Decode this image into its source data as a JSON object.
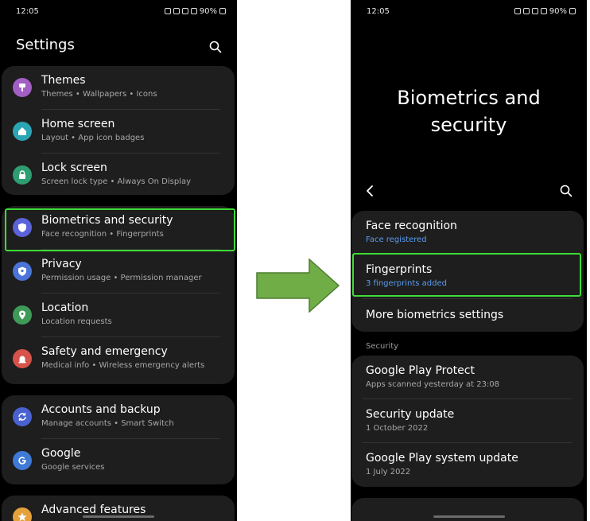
{
  "colors": {
    "highlight": "#3ddc36",
    "arrow_fill": "#70ad47",
    "arrow_stroke": "#4e7d30",
    "link_blue": "#5a9cf0",
    "themes_icon": "#a25fc4",
    "home_icon": "#2aa5b4",
    "lock_icon": "#2f9d72",
    "biometrics_icon": "#5a63d8",
    "privacy_icon": "#4a74d8",
    "location_icon": "#3e9a57",
    "safety_icon": "#d6524a",
    "accounts_icon": "#4a62d0",
    "google_icon": "#3e7ad6",
    "advanced_icon": "#e5a13a"
  },
  "left": {
    "status": {
      "time": "12:05",
      "battery": "90%"
    },
    "header": {
      "title": "Settings",
      "search_icon": "search-icon"
    },
    "group1": [
      {
        "title": "Themes",
        "subtitle": "Themes • Wallpapers • Icons",
        "icon": "themes-icon"
      },
      {
        "title": "Home screen",
        "subtitle": "Layout • App icon badges",
        "icon": "home-icon"
      },
      {
        "title": "Lock screen",
        "subtitle": "Screen lock type • Always On Display",
        "icon": "lock-icon"
      }
    ],
    "group2": [
      {
        "title": "Biometrics and security",
        "subtitle": "Face recognition • Fingerprints",
        "icon": "shield-icon"
      },
      {
        "title": "Privacy",
        "subtitle": "Permission usage • Permission manager",
        "icon": "privacy-shield-icon"
      },
      {
        "title": "Location",
        "subtitle": "Location requests",
        "icon": "location-pin-icon"
      },
      {
        "title": "Safety and emergency",
        "subtitle": "Medical info • Wireless emergency alerts",
        "icon": "siren-icon"
      }
    ],
    "group3": [
      {
        "title": "Accounts and backup",
        "subtitle": "Manage accounts • Smart Switch",
        "icon": "sync-icon"
      },
      {
        "title": "Google",
        "subtitle": "Google services",
        "icon": "google-icon"
      }
    ],
    "group4": [
      {
        "title": "Advanced features",
        "icon": "star-icon"
      }
    ]
  },
  "right": {
    "status": {
      "time": "12:05",
      "battery": "90%"
    },
    "page_title": "Biometrics and security",
    "back_icon": "back-arrow-icon",
    "search_icon": "search-icon",
    "biometrics_group": [
      {
        "title": "Face recognition",
        "subtitle": "Face registered"
      },
      {
        "title": "Fingerprints",
        "subtitle": "3 fingerprints added"
      },
      {
        "title": "More biometrics settings"
      }
    ],
    "security_label": "Security",
    "security_group": [
      {
        "title": "Google Play Protect",
        "subtitle": "Apps scanned yesterday at 23:08"
      },
      {
        "title": "Security update",
        "subtitle": "1 October 2022"
      },
      {
        "title": "Google Play system update",
        "subtitle": "1 July 2022"
      }
    ]
  }
}
